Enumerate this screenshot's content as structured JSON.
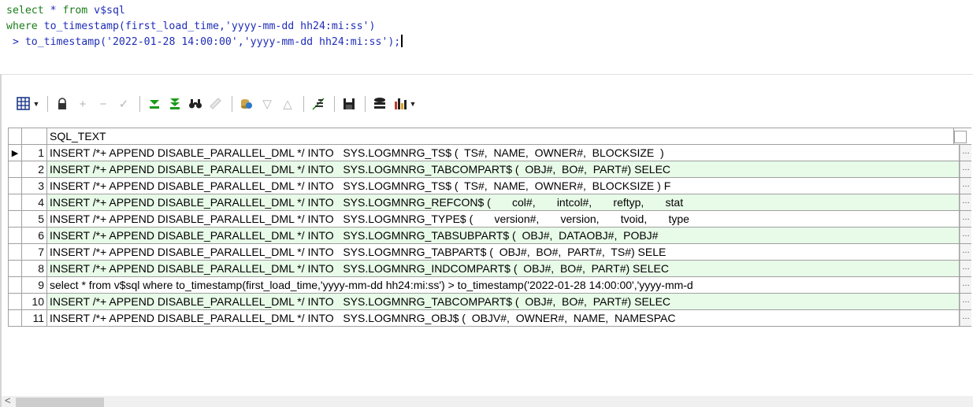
{
  "editor": {
    "line1": {
      "select": "select",
      "star": " * ",
      "from": "from",
      "table": " v$sql"
    },
    "line2": {
      "where": "where",
      "func": " to_timestamp(first_load_time,",
      "fmt": "'yyyy-mm-dd hh24:mi:ss'",
      "close": ")"
    },
    "line3": {
      "gt": " > to_timestamp(",
      "date": "'2022-01-28 14:00:00'",
      "comma": ",",
      "fmt": "'yyyy-mm-dd hh24:mi:ss'",
      "end": ");"
    }
  },
  "toolbar": {
    "buttons": [
      "grid-view",
      "dropdown",
      "lock",
      "add",
      "remove",
      "post",
      "fetch-next",
      "fetch-all",
      "find",
      "clear",
      "query-by-example",
      "filter-down",
      "filter-up",
      "export",
      "save",
      "chart-options",
      "chart",
      "dropdown"
    ]
  },
  "grid": {
    "column": "SQL_TEXT",
    "ellipsis": "…",
    "rows": [
      {
        "n": "1",
        "text": "INSERT /*+ APPEND DISABLE_PARALLEL_DML */ INTO   SYS.LOGMNRG_TS$ (  TS#,  NAME,  OWNER#,  BLOCKSIZE  )"
      },
      {
        "n": "2",
        "text": "INSERT /*+ APPEND DISABLE_PARALLEL_DML */ INTO   SYS.LOGMNRG_TABCOMPART$ (  OBJ#,  BO#,  PART#) SELEC"
      },
      {
        "n": "3",
        "text": "INSERT /*+ APPEND DISABLE_PARALLEL_DML */ INTO   SYS.LOGMNRG_TS$ (  TS#,  NAME,  OWNER#,  BLOCKSIZE ) F"
      },
      {
        "n": "4",
        "text": "INSERT /*+ APPEND DISABLE_PARALLEL_DML */ INTO   SYS.LOGMNRG_REFCON$ (       col#,       intcol#,       reftyp,       stat"
      },
      {
        "n": "5",
        "text": "INSERT /*+ APPEND DISABLE_PARALLEL_DML */ INTO   SYS.LOGMNRG_TYPE$ (       version#,       version,       tvoid,       type"
      },
      {
        "n": "6",
        "text": "INSERT /*+ APPEND DISABLE_PARALLEL_DML */ INTO   SYS.LOGMNRG_TABSUBPART$ (  OBJ#,  DATAOBJ#,  POBJ#  "
      },
      {
        "n": "7",
        "text": "INSERT /*+ APPEND DISABLE_PARALLEL_DML */ INTO   SYS.LOGMNRG_TABPART$ (  OBJ#,  BO#,  PART#,  TS#) SELE"
      },
      {
        "n": "8",
        "text": "INSERT /*+ APPEND DISABLE_PARALLEL_DML */ INTO   SYS.LOGMNRG_INDCOMPART$ (  OBJ#,  BO#,  PART#) SELEC"
      },
      {
        "n": "9",
        "text": "select * from v$sql where to_timestamp(first_load_time,'yyyy-mm-dd hh24:mi:ss') > to_timestamp('2022-01-28 14:00:00','yyyy-mm-d"
      },
      {
        "n": "10",
        "text": "INSERT /*+ APPEND DISABLE_PARALLEL_DML */ INTO   SYS.LOGMNRG_TABCOMPART$ (  OBJ#,  BO#,  PART#) SELEC"
      },
      {
        "n": "11",
        "text": "INSERT /*+ APPEND DISABLE_PARALLEL_DML */ INTO   SYS.LOGMNRG_OBJ$ (  OBJV#,  OWNER#,  NAME,  NAMESPAC"
      }
    ]
  },
  "scrollbar": {
    "left_arrow": "<"
  }
}
